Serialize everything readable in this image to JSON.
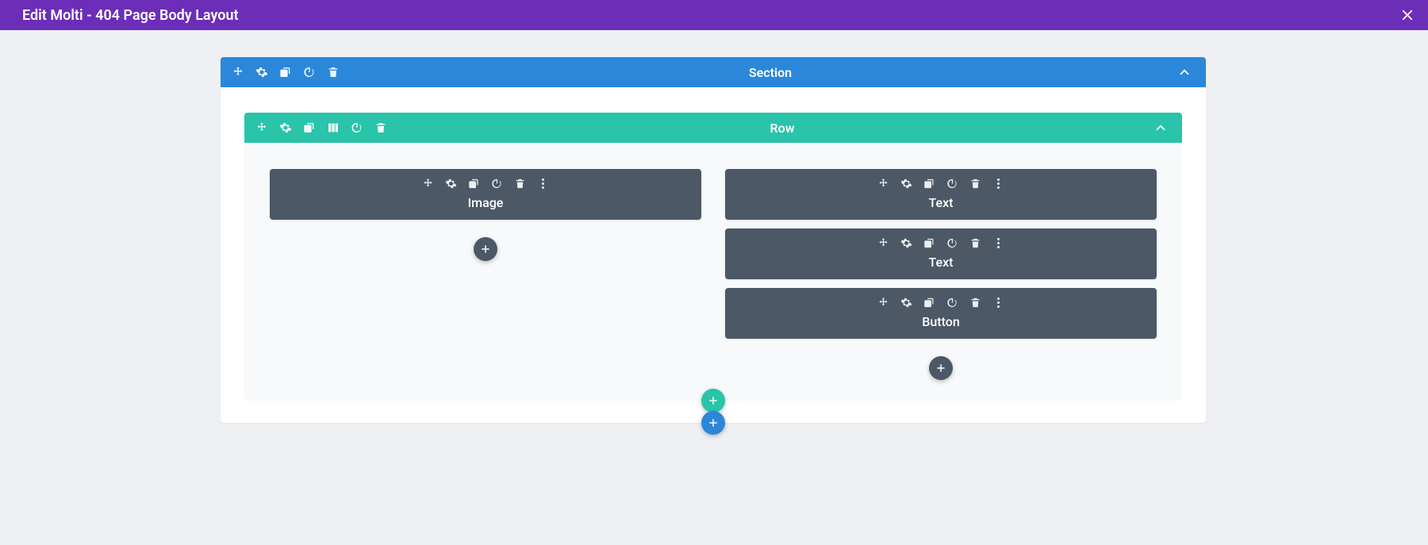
{
  "header": {
    "title": "Edit Molti - 404 Page Body Layout"
  },
  "section": {
    "label": "Section",
    "row": {
      "label": "Row",
      "columns": [
        {
          "modules": [
            {
              "label": "Image"
            }
          ]
        },
        {
          "modules": [
            {
              "label": "Text"
            },
            {
              "label": "Text"
            },
            {
              "label": "Button"
            }
          ]
        }
      ]
    }
  },
  "colors": {
    "header": "#6c2eb9",
    "section": "#2b87da",
    "row": "#29c4a9",
    "module": "#4c5866"
  }
}
